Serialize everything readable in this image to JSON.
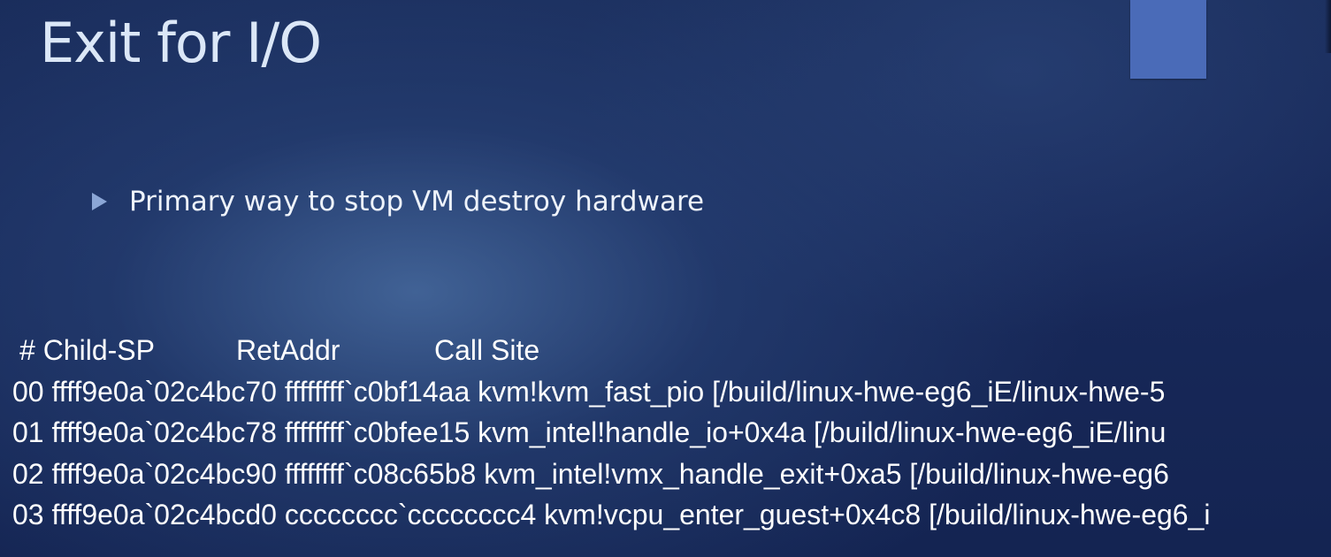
{
  "slide": {
    "title": "Exit for I/O",
    "bullets": [
      "Primary way to stop VM destroy hardware"
    ],
    "stack_trace": {
      "headers": {
        "child_sp": "# Child-SP",
        "ret_addr": "RetAddr",
        "call_site": "Call Site"
      },
      "rows": [
        "00 ffff9e0a`02c4bc70 ffffffff`c0bf14aa kvm!kvm_fast_pio [/build/linux-hwe-eg6_iE/linux-hwe-5",
        "01 ffff9e0a`02c4bc78 ffffffff`c0bfee15 kvm_intel!handle_io+0x4a [/build/linux-hwe-eg6_iE/linu",
        "02 ffff9e0a`02c4bc90 ffffffff`c08c65b8 kvm_intel!vmx_handle_exit+0xa5 [/build/linux-hwe-eg6",
        "03 ffff9e0a`02c4bcd0 cccccccc`cccccccc4 kvm!vcpu_enter_guest+0x4c8 [/build/linux-hwe-eg6_i"
      ]
    }
  },
  "colors": {
    "background": "#18295a",
    "accent_block": "#4a6bb8",
    "title_text": "#dbe7f7",
    "bullet_marker": "#8ba6d6",
    "body_text": "#ffffff"
  },
  "icons": {
    "bullet": "triangle-right-icon"
  }
}
